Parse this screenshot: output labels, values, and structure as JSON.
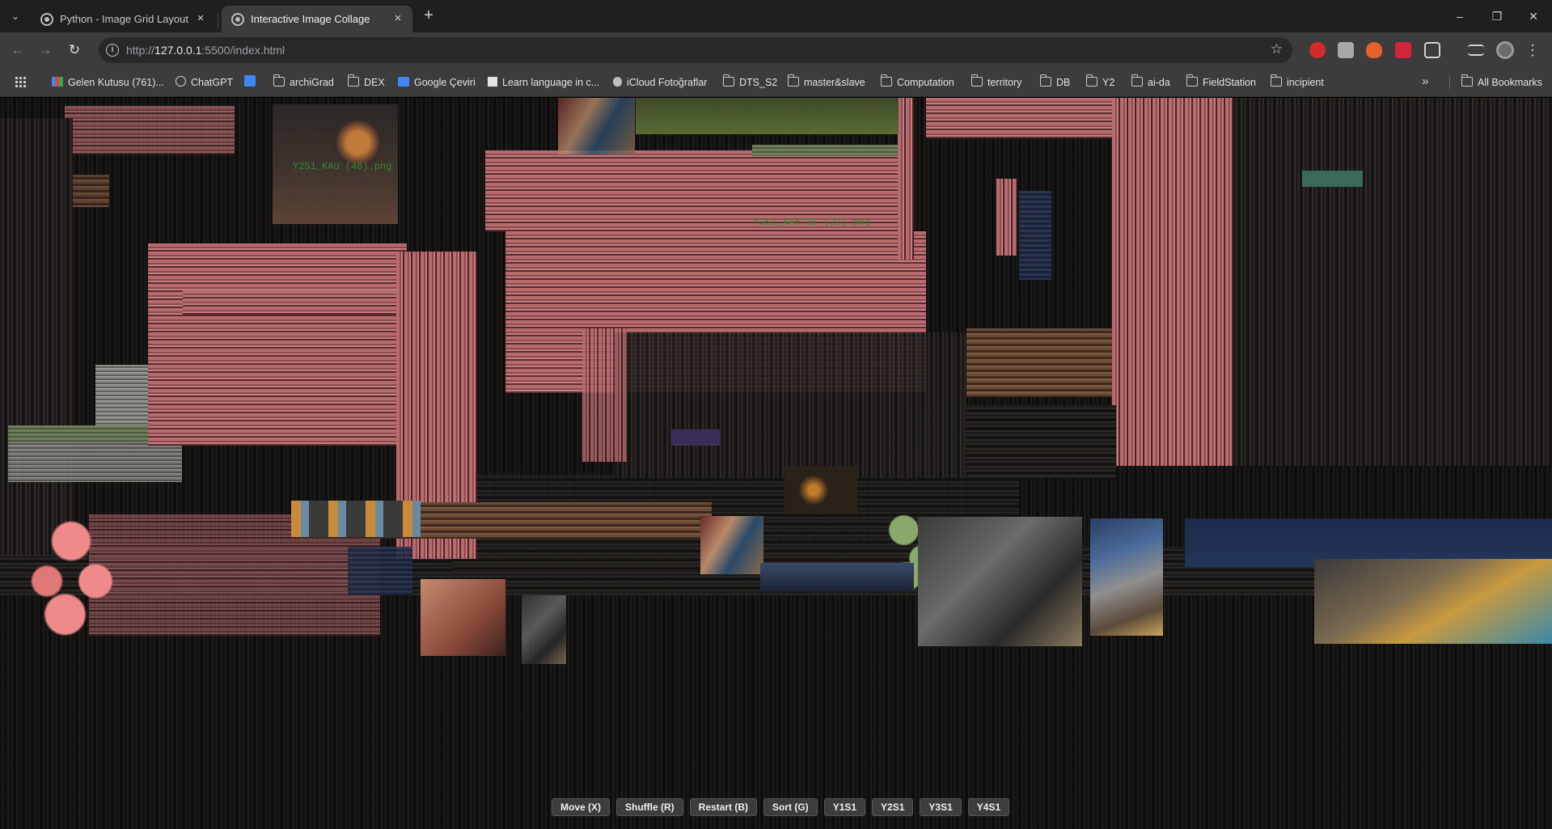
{
  "browser": {
    "tabs": [
      {
        "title": "Python - Image Grid Layout Enh",
        "active": false
      },
      {
        "title": "Interactive Image Collage",
        "active": true
      }
    ],
    "address": {
      "prefix": "http://",
      "host": "127.0.0.1",
      "path": ":5500/index.html"
    },
    "icons": {
      "tab_search": "chevron-down-icon",
      "new_tab": "plus-icon",
      "back": "arrow-left-icon",
      "forward": "arrow-right-icon",
      "reload": "reload-icon",
      "site_info": "info-icon",
      "bookmark_star": "star-icon"
    },
    "window_controls": {
      "minimize": "–",
      "restore": "❐",
      "close": "✕"
    }
  },
  "bookmarks": {
    "items": [
      {
        "label": "Gelen Kutusu (761)...",
        "icon": "gmail-icon"
      },
      {
        "label": "ChatGPT",
        "icon": "chatgpt-icon"
      },
      {
        "label": "",
        "icon": "calendar-icon"
      },
      {
        "label": "archiGrad",
        "icon": "folder-icon"
      },
      {
        "label": "DEX",
        "icon": "folder-icon"
      },
      {
        "label": "Google Çeviri",
        "icon": "translate-icon"
      },
      {
        "label": "Learn language in c...",
        "icon": "site-icon"
      },
      {
        "label": "iCloud Fotoğraflar",
        "icon": "apple-icon"
      },
      {
        "label": "DTS_S2",
        "icon": "folder-icon"
      },
      {
        "label": "master&slave",
        "icon": "folder-icon"
      },
      {
        "label": "Computation",
        "icon": "folder-icon"
      },
      {
        "label": "territory",
        "icon": "folder-icon"
      },
      {
        "label": "DB",
        "icon": "folder-icon"
      },
      {
        "label": "Y2",
        "icon": "folder-icon"
      },
      {
        "label": "ai-da",
        "icon": "folder-icon"
      },
      {
        "label": "FieldStation",
        "icon": "folder-icon"
      },
      {
        "label": "incipient",
        "icon": "folder-icon"
      }
    ],
    "more": "»",
    "all_bookmarks": "All Bookmarks"
  },
  "collage": {
    "labels": [
      "Y2S1_KAU (48).png",
      "Y3S1_KAYTIE (21).png"
    ],
    "controls": [
      {
        "label": "Move (X)"
      },
      {
        "label": "Shuffle (R)"
      },
      {
        "label": "Restart (B)"
      },
      {
        "label": "Sort (G)"
      },
      {
        "label": "Y1S1"
      },
      {
        "label": "Y2S1"
      },
      {
        "label": "Y3S1"
      },
      {
        "label": "Y4S1"
      }
    ]
  }
}
